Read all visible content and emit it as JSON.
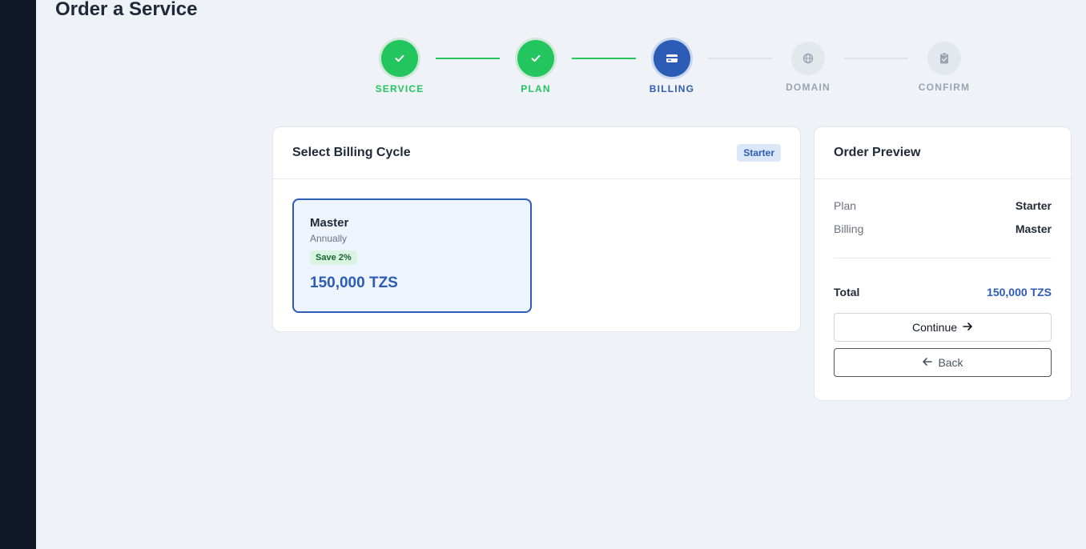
{
  "page": {
    "title": "Order a Service"
  },
  "stepper": {
    "steps": [
      {
        "label": "SERVICE",
        "state": "done",
        "icon": "check-icon"
      },
      {
        "label": "PLAN",
        "state": "done",
        "icon": "check-icon"
      },
      {
        "label": "BILLING",
        "state": "active",
        "icon": "credit-card-icon"
      },
      {
        "label": "DOMAIN",
        "state": "todo",
        "icon": "globe-icon"
      },
      {
        "label": "CONFIRM",
        "state": "todo",
        "icon": "clipboard-check-icon"
      }
    ]
  },
  "billing": {
    "title": "Select Billing Cycle",
    "plan_badge": "Starter",
    "options": [
      {
        "name": "Master",
        "period": "Annually",
        "save": "Save 2%",
        "price": "150,000 TZS",
        "selected": true
      }
    ]
  },
  "preview": {
    "title": "Order Preview",
    "rows": [
      {
        "key": "Plan",
        "value": "Starter"
      },
      {
        "key": "Billing",
        "value": "Master"
      }
    ],
    "total_label": "Total",
    "total_value": "150,000 TZS",
    "continue_label": "Continue",
    "back_label": "Back"
  },
  "colors": {
    "accent": "#2c5cb6",
    "success": "#22c55e",
    "sidebar": "#111827",
    "background": "#eff2f7"
  }
}
